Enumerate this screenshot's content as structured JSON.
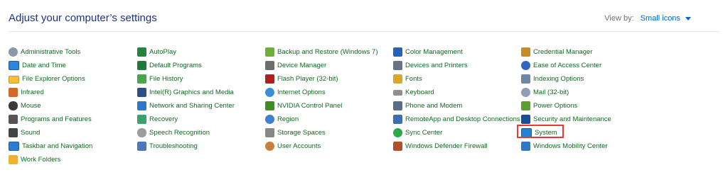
{
  "header": {
    "title": "Adjust your computer’s settings",
    "view_by_label": "View by:",
    "view_by_value": "Small icons"
  },
  "items": {
    "administrative_tools": {
      "label": "Administrative Tools"
    },
    "date_and_time": {
      "label": "Date and Time"
    },
    "file_explorer_options": {
      "label": "File Explorer Options"
    },
    "infrared": {
      "label": "Infrared"
    },
    "mouse": {
      "label": "Mouse"
    },
    "programs_and_features": {
      "label": "Programs and Features"
    },
    "sound": {
      "label": "Sound"
    },
    "taskbar_and_navigation": {
      "label": "Taskbar and Navigation"
    },
    "work_folders": {
      "label": "Work Folders"
    },
    "autoplay": {
      "label": "AutoPlay"
    },
    "default_programs": {
      "label": "Default Programs"
    },
    "file_history": {
      "label": "File History"
    },
    "intel_graphics": {
      "label": "Intel(R) Graphics and Media"
    },
    "network_sharing": {
      "label": "Network and Sharing Center"
    },
    "recovery": {
      "label": "Recovery"
    },
    "speech_recognition": {
      "label": "Speech Recognition"
    },
    "troubleshooting": {
      "label": "Troubleshooting"
    },
    "backup_restore": {
      "label": "Backup and Restore (Windows 7)"
    },
    "device_manager": {
      "label": "Device Manager"
    },
    "flash_player": {
      "label": "Flash Player (32-bit)"
    },
    "internet_options": {
      "label": "Internet Options"
    },
    "nvidia_control_panel": {
      "label": "NVIDIA Control Panel"
    },
    "region": {
      "label": "Region"
    },
    "storage_spaces": {
      "label": "Storage Spaces"
    },
    "user_accounts": {
      "label": "User Accounts"
    },
    "color_management": {
      "label": "Color Management"
    },
    "devices_printers": {
      "label": "Devices and Printers"
    },
    "fonts": {
      "label": "Fonts"
    },
    "keyboard": {
      "label": "Keyboard"
    },
    "phone_modem": {
      "label": "Phone and Modem"
    },
    "remoteapp": {
      "label": "RemoteApp and Desktop Connections"
    },
    "sync_center": {
      "label": "Sync Center"
    },
    "defender_firewall": {
      "label": "Windows Defender Firewall"
    },
    "credential_manager": {
      "label": "Credential Manager"
    },
    "ease_of_access": {
      "label": "Ease of Access Center"
    },
    "indexing_options": {
      "label": "Indexing Options"
    },
    "mail": {
      "label": "Mail (32-bit)"
    },
    "power_options": {
      "label": "Power Options"
    },
    "security_maintenance": {
      "label": "Security and Maintenance"
    },
    "system": {
      "label": "System"
    },
    "windows_mobility_center": {
      "label": "Windows Mobility Center"
    }
  },
  "colors": {
    "title": "#1e3287",
    "link": "#0f6b1f",
    "view_by_value": "#0066cc",
    "highlight": "#e53935"
  }
}
